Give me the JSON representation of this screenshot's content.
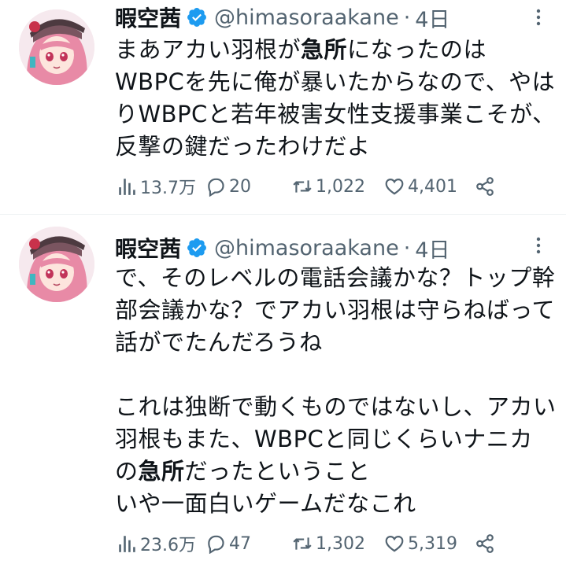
{
  "tweets": [
    {
      "display_name": "暇空茜",
      "handle": "@himasoraakane",
      "separator": "·",
      "time": "4日",
      "lines": [
        [
          {
            "t": "まあアカい羽根が"
          },
          {
            "t": "急所",
            "b": true
          },
          {
            "t": "になったのは"
          }
        ],
        [
          {
            "t": "WBPCを先に俺が暴いたからなので、やは"
          }
        ],
        [
          {
            "t": "りWBPCと若年被害女性支援事業こそが、"
          }
        ],
        [
          {
            "t": "反撃の鍵だったわけだよ"
          }
        ]
      ],
      "views": "13.7万",
      "replies": "20",
      "retweets": "1,022",
      "likes": "4,401"
    },
    {
      "display_name": "暇空茜",
      "handle": "@himasoraakane",
      "separator": "·",
      "time": "4日",
      "lines": [
        [
          {
            "t": "で、そのレベルの電話会議かな？トップ幹"
          }
        ],
        [
          {
            "t": "部会議かな？でアカい羽根は守らねばって"
          }
        ],
        [
          {
            "t": "話がでたんだろうね"
          }
        ],
        [
          {
            "t": ""
          }
        ],
        [
          {
            "t": "これは独断で動くものではないし、アカい"
          }
        ],
        [
          {
            "t": "羽根もまた、WBPCと同じくらいナニカ"
          }
        ],
        [
          {
            "t": "の"
          },
          {
            "t": "急所",
            "b": true
          },
          {
            "t": "だったということ"
          }
        ],
        [
          {
            "t": "いや一面白いゲームだなこれ"
          }
        ]
      ],
      "views": "23.6万",
      "replies": "47",
      "retweets": "1,302",
      "likes": "5,319"
    }
  ],
  "icons": {
    "verified": "verified-badge-icon",
    "more": "more-options-icon",
    "views": "views-bar-chart-icon",
    "reply": "reply-bubble-icon",
    "retweet": "retweet-icon",
    "like": "heart-icon",
    "share": "share-icon"
  },
  "colors": {
    "verified_badge": "#1d9bf0",
    "secondary_text": "#536471",
    "primary_text": "#0f1419",
    "divider": "#eff3f4"
  }
}
